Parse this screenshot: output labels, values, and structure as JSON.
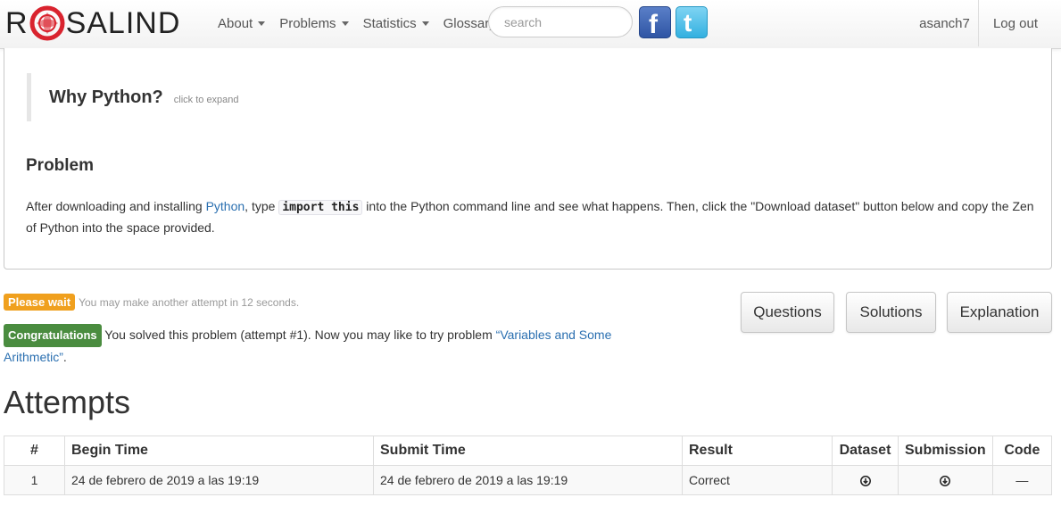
{
  "nav": {
    "brand_left": "R",
    "brand_right": "SALIND",
    "menu": [
      {
        "label": "About",
        "dropdown": true
      },
      {
        "label": "Problems",
        "dropdown": true
      },
      {
        "label": "Statistics",
        "dropdown": true
      },
      {
        "label": "Glossary",
        "dropdown": false
      }
    ],
    "search_placeholder": "search",
    "social_icons": [
      "facebook-icon",
      "twitter-icon"
    ],
    "user": "asanch7",
    "logout": "Log out"
  },
  "problem": {
    "why_title": "Why Python?",
    "why_hint": "click to expand",
    "title": "Problem",
    "text_before_link": "After downloading and installing ",
    "link": "Python",
    "text_before_code": ", type ",
    "code": "import this",
    "text_after_code": " into the Python command line and see what happens. Then, click the \"Download dataset\" button below and copy the Zen of Python into the space provided."
  },
  "status": {
    "wait_label": "Please wait",
    "wait_text": "You may make another attempt in 12 seconds.",
    "congrats_label": "Congratulations",
    "congrats_text": " You solved this problem (attempt #1). Now you may like to try problem ",
    "next_problem": "“Variables and Some Arithmetic”",
    "congrats_end": "."
  },
  "buttons": {
    "questions": "Questions",
    "solutions": "Solutions",
    "explanation": "Explanation"
  },
  "attempts": {
    "title": "Attempts",
    "headers": [
      "#",
      "Begin Time",
      "Submit Time",
      "Result",
      "Dataset",
      "Submission",
      "Code"
    ],
    "rows": [
      {
        "num": "1",
        "begin": "24 de febrero de 2019 a las 19:19",
        "submit": "24 de febrero de 2019 a las 19:19",
        "result": "Correct",
        "dataset_icon": "download-icon",
        "submission_icon": "download-icon",
        "code": "—"
      }
    ]
  },
  "colors": {
    "brand_red": "#d9232e",
    "link": "#2a6fb0",
    "warning": "#f0a01e",
    "success": "#4a8c3f"
  }
}
